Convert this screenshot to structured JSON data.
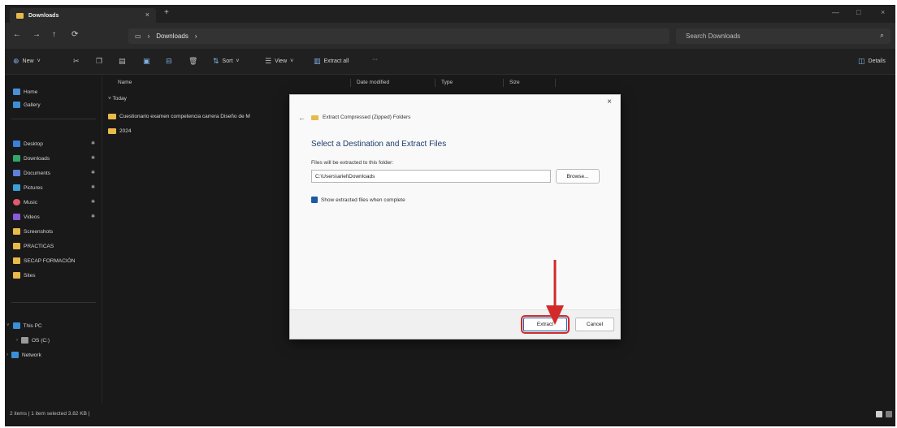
{
  "window": {
    "tab_title": "Downloads",
    "tab_close": "×",
    "tab_new": "+",
    "controls": [
      "—",
      "□",
      "×"
    ]
  },
  "navigation": {
    "back": "←",
    "forward": "→",
    "up": "↑",
    "refresh": "⟳",
    "breadcrumb": [
      "Downloads"
    ],
    "breadcrumb_sep": "›",
    "search_placeholder": "Search Downloads"
  },
  "commandbar": {
    "new_label": "New",
    "sort_label": "Sort",
    "view_label": "View",
    "extract_all_label": "Extract all",
    "more_label": "···",
    "details_label": "Details"
  },
  "sidebar": {
    "top_items": [
      {
        "label": "Home",
        "color": "#4a90d9"
      },
      {
        "label": "Gallery",
        "color": "#3a8fd8"
      }
    ],
    "pinned_items": [
      {
        "label": "Desktop",
        "color": "#3a7fd8",
        "pin": "📌"
      },
      {
        "label": "Downloads",
        "color": "#2fa86a",
        "pin": "📌"
      },
      {
        "label": "Documents",
        "color": "#5f7fd8",
        "pin": "📌"
      },
      {
        "label": "Pictures",
        "color": "#3aa0d8",
        "pin": "📌"
      },
      {
        "label": "Music",
        "color": "#e05a6a",
        "pin": "📌"
      },
      {
        "label": "Videos",
        "color": "#8a5ad8",
        "pin": "📌"
      }
    ],
    "folders": [
      "Screenshots",
      "PRACTICAS",
      "SECAP FORMACIÓN",
      "Sites"
    ],
    "system_items": [
      {
        "label": "This PC",
        "color": "#3a8fd8"
      },
      {
        "label": "OS (C:)",
        "color": "#9a9a9a"
      },
      {
        "label": "Network",
        "color": "#3a8fd8"
      }
    ]
  },
  "filelist": {
    "columns": [
      "Name",
      "Date modified",
      "Type",
      "Size"
    ],
    "group_label": "Today",
    "rows": [
      "Cuestionario examen competencia carrera Diseño de M",
      "2024"
    ]
  },
  "status": {
    "text": "2 items  |  1 item selected  3.82 KB  |"
  },
  "dialog": {
    "close": "×",
    "back": "←",
    "header": "Extract Compressed (Zipped) Folders",
    "title": "Select a Destination and Extract Files",
    "path_label": "Files will be extracted to this folder:",
    "path_value": "C:\\Users\\ariel\\Downloads",
    "browse_label": "Browse...",
    "show_files_label": "Show extracted files when complete",
    "extract_label": "Extract",
    "cancel_label": "Cancel"
  },
  "colors": {
    "annotation": "#d22a2a",
    "accent": "#1c5aa6"
  }
}
